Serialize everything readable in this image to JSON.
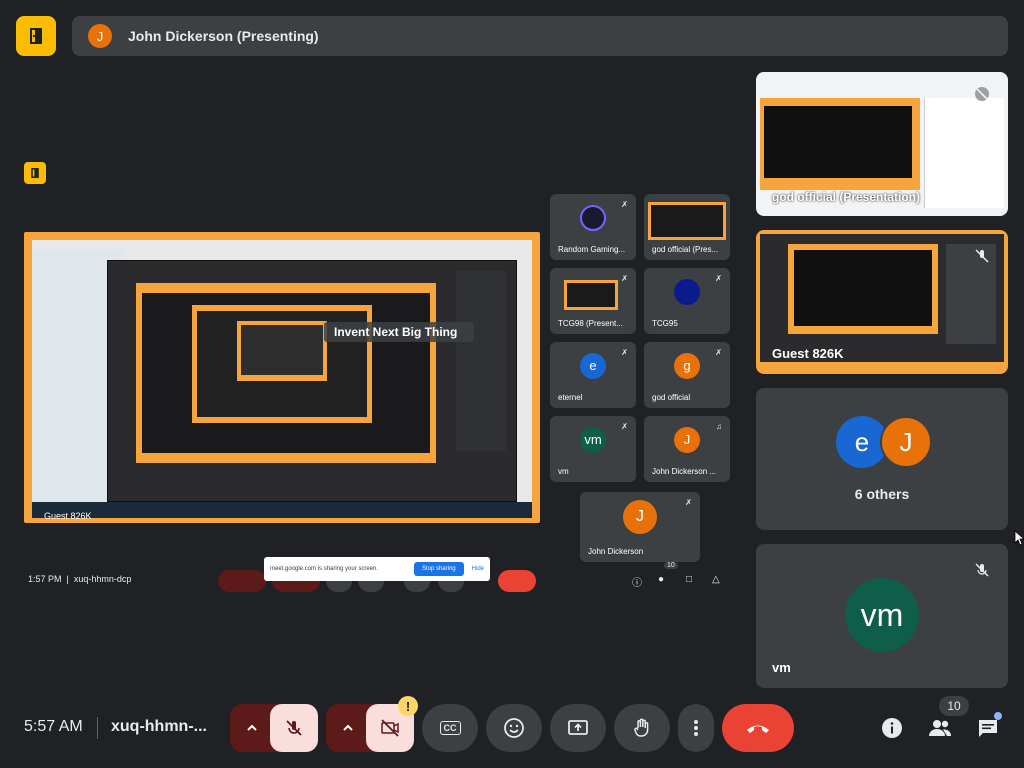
{
  "header": {
    "presenter_initial": "J",
    "presenter_label": "John Dickerson (Presenting)"
  },
  "shared_screen": {
    "overlay_label": "Invent Next Big Thing",
    "guest_label": "Guest 826K"
  },
  "mini_tiles": [
    {
      "name": "Random Gaming...",
      "initial": ""
    },
    {
      "name": "god official (Pres...",
      "initial": ""
    },
    {
      "name": "TCG98 (Present...",
      "initial": ""
    },
    {
      "name": "TCG95",
      "initial": ""
    },
    {
      "name": "eternel",
      "initial": "e"
    },
    {
      "name": "god official",
      "initial": "g"
    },
    {
      "name": "vm",
      "initial": "vm"
    },
    {
      "name": "John Dickerson ...",
      "initial": "J"
    },
    {
      "name": "John Dickerson",
      "initial": "J"
    }
  ],
  "inner_bar": {
    "time": "1:57 PM",
    "code": "xuq-hhmn-dcp",
    "participant_count": "10"
  },
  "toast": {
    "text": "meet.google.com is sharing your screen.",
    "stop_label": "Stop sharing",
    "hide_label": "Hide"
  },
  "side_tiles": {
    "tile1_label": "god official (Presentation)",
    "tile2_label": "Guest 826K",
    "others_initial_1": "e",
    "others_initial_2": "J",
    "others_label": "6 others",
    "vm_initial": "vm",
    "vm_label": "vm"
  },
  "bottom_bar": {
    "time": "5:57 AM",
    "code": "xuq-hhmn-...",
    "cc_label": "CC",
    "warning_mark": "!",
    "participant_count": "10"
  },
  "colors": {
    "background": "#202124",
    "tile": "#3c4043",
    "accent_yellow": "#fbbc04",
    "end_call_red": "#ea4335",
    "muted_dark_red": "#5c1a18",
    "avatar_orange": "#e8710a",
    "avatar_blue": "#1967d2",
    "avatar_green": "#0f5e4a"
  }
}
